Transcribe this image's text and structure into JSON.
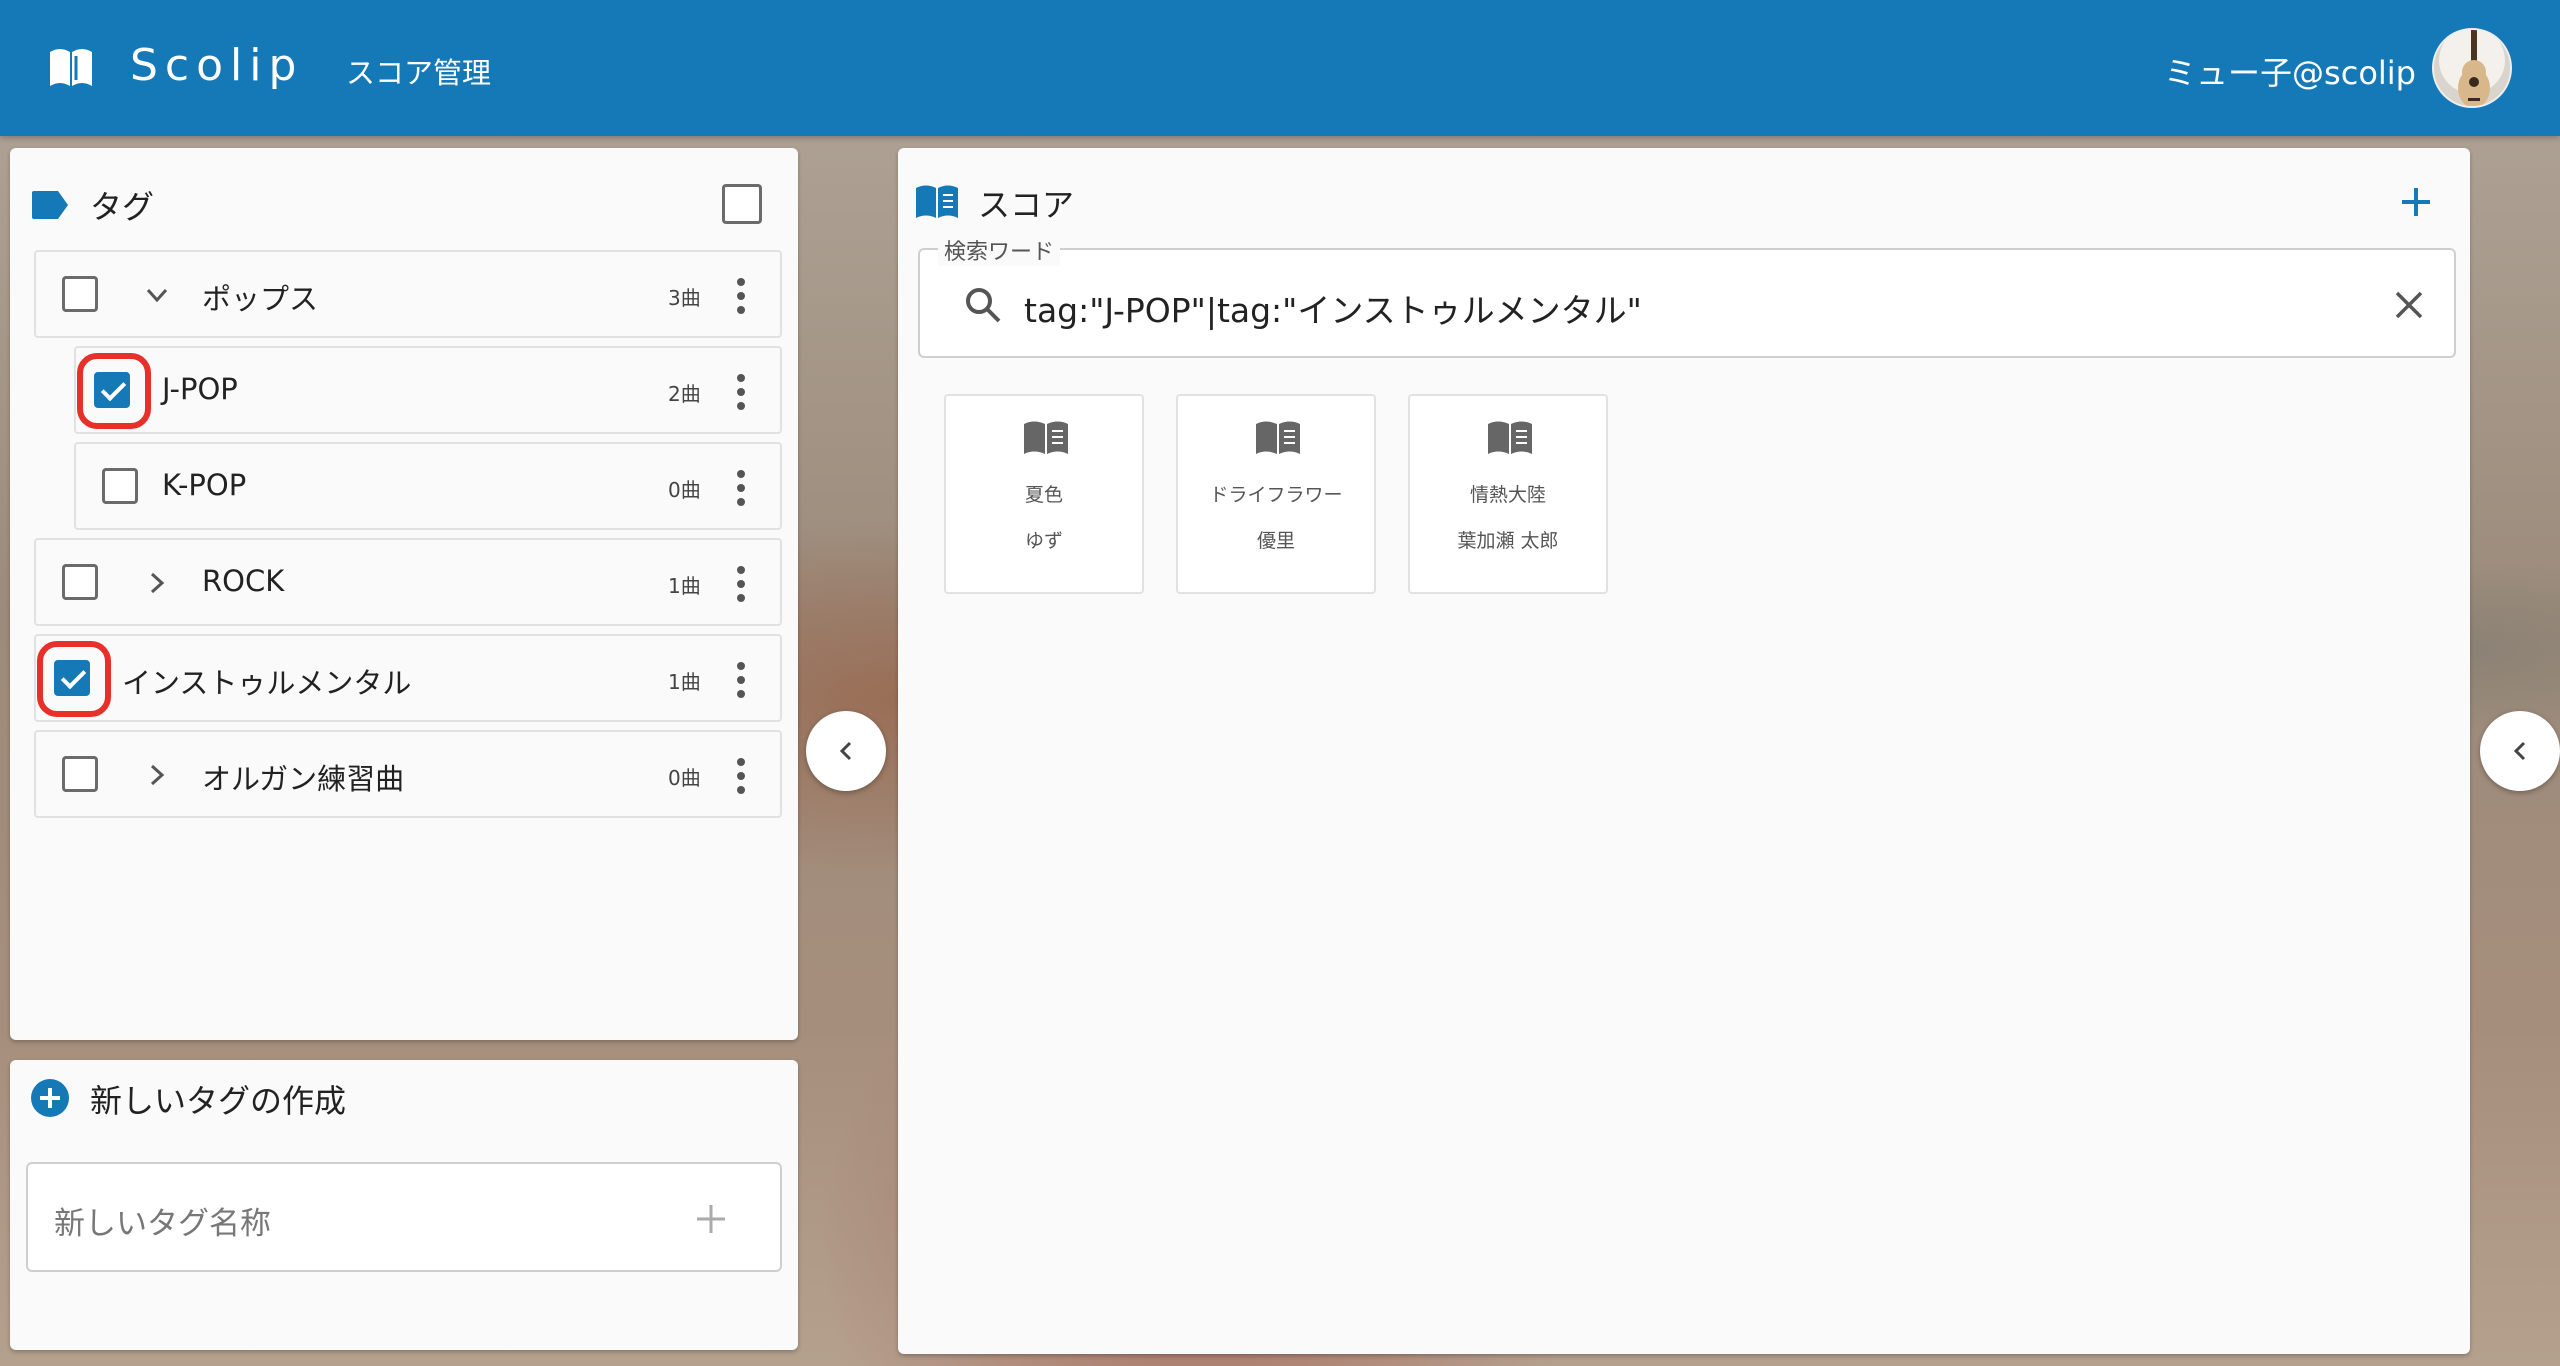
{
  "colors": {
    "primary": "#1479b6",
    "highlight": "#e8302a"
  },
  "header": {
    "brand": "Scolip",
    "nav_label": "スコア管理",
    "user_name": "ミュー子@scolip"
  },
  "tag_panel": {
    "title": "タグ",
    "tags": [
      {
        "label": "ポップス",
        "count": "3曲",
        "checked": false,
        "expander": "chevron-down-icon"
      },
      {
        "label": "J-POP",
        "count": "2曲",
        "checked": true,
        "child": true
      },
      {
        "label": "K-POP",
        "count": "0曲",
        "checked": false,
        "child": true
      },
      {
        "label": "ROCK",
        "count": "1曲",
        "checked": false,
        "expander": "chevron-right-icon"
      },
      {
        "label": "インストゥルメンタル",
        "count": "1曲",
        "checked": true
      },
      {
        "label": "オルガン練習曲",
        "count": "0曲",
        "checked": false,
        "expander": "chevron-right-icon"
      }
    ]
  },
  "new_tag": {
    "title": "新しいタグの作成",
    "placeholder": "新しいタグ名称"
  },
  "score_panel": {
    "title": "スコア",
    "search": {
      "legend": "検索ワード",
      "value": "tag:\"J-POP\"|tag:\"インストゥルメンタル\""
    },
    "scores": [
      {
        "title": "夏色",
        "artist": "ゆず"
      },
      {
        "title": "ドライフラワー",
        "artist": "優里"
      },
      {
        "title": "情熱大陸",
        "artist": "葉加瀬 太郎"
      }
    ]
  }
}
